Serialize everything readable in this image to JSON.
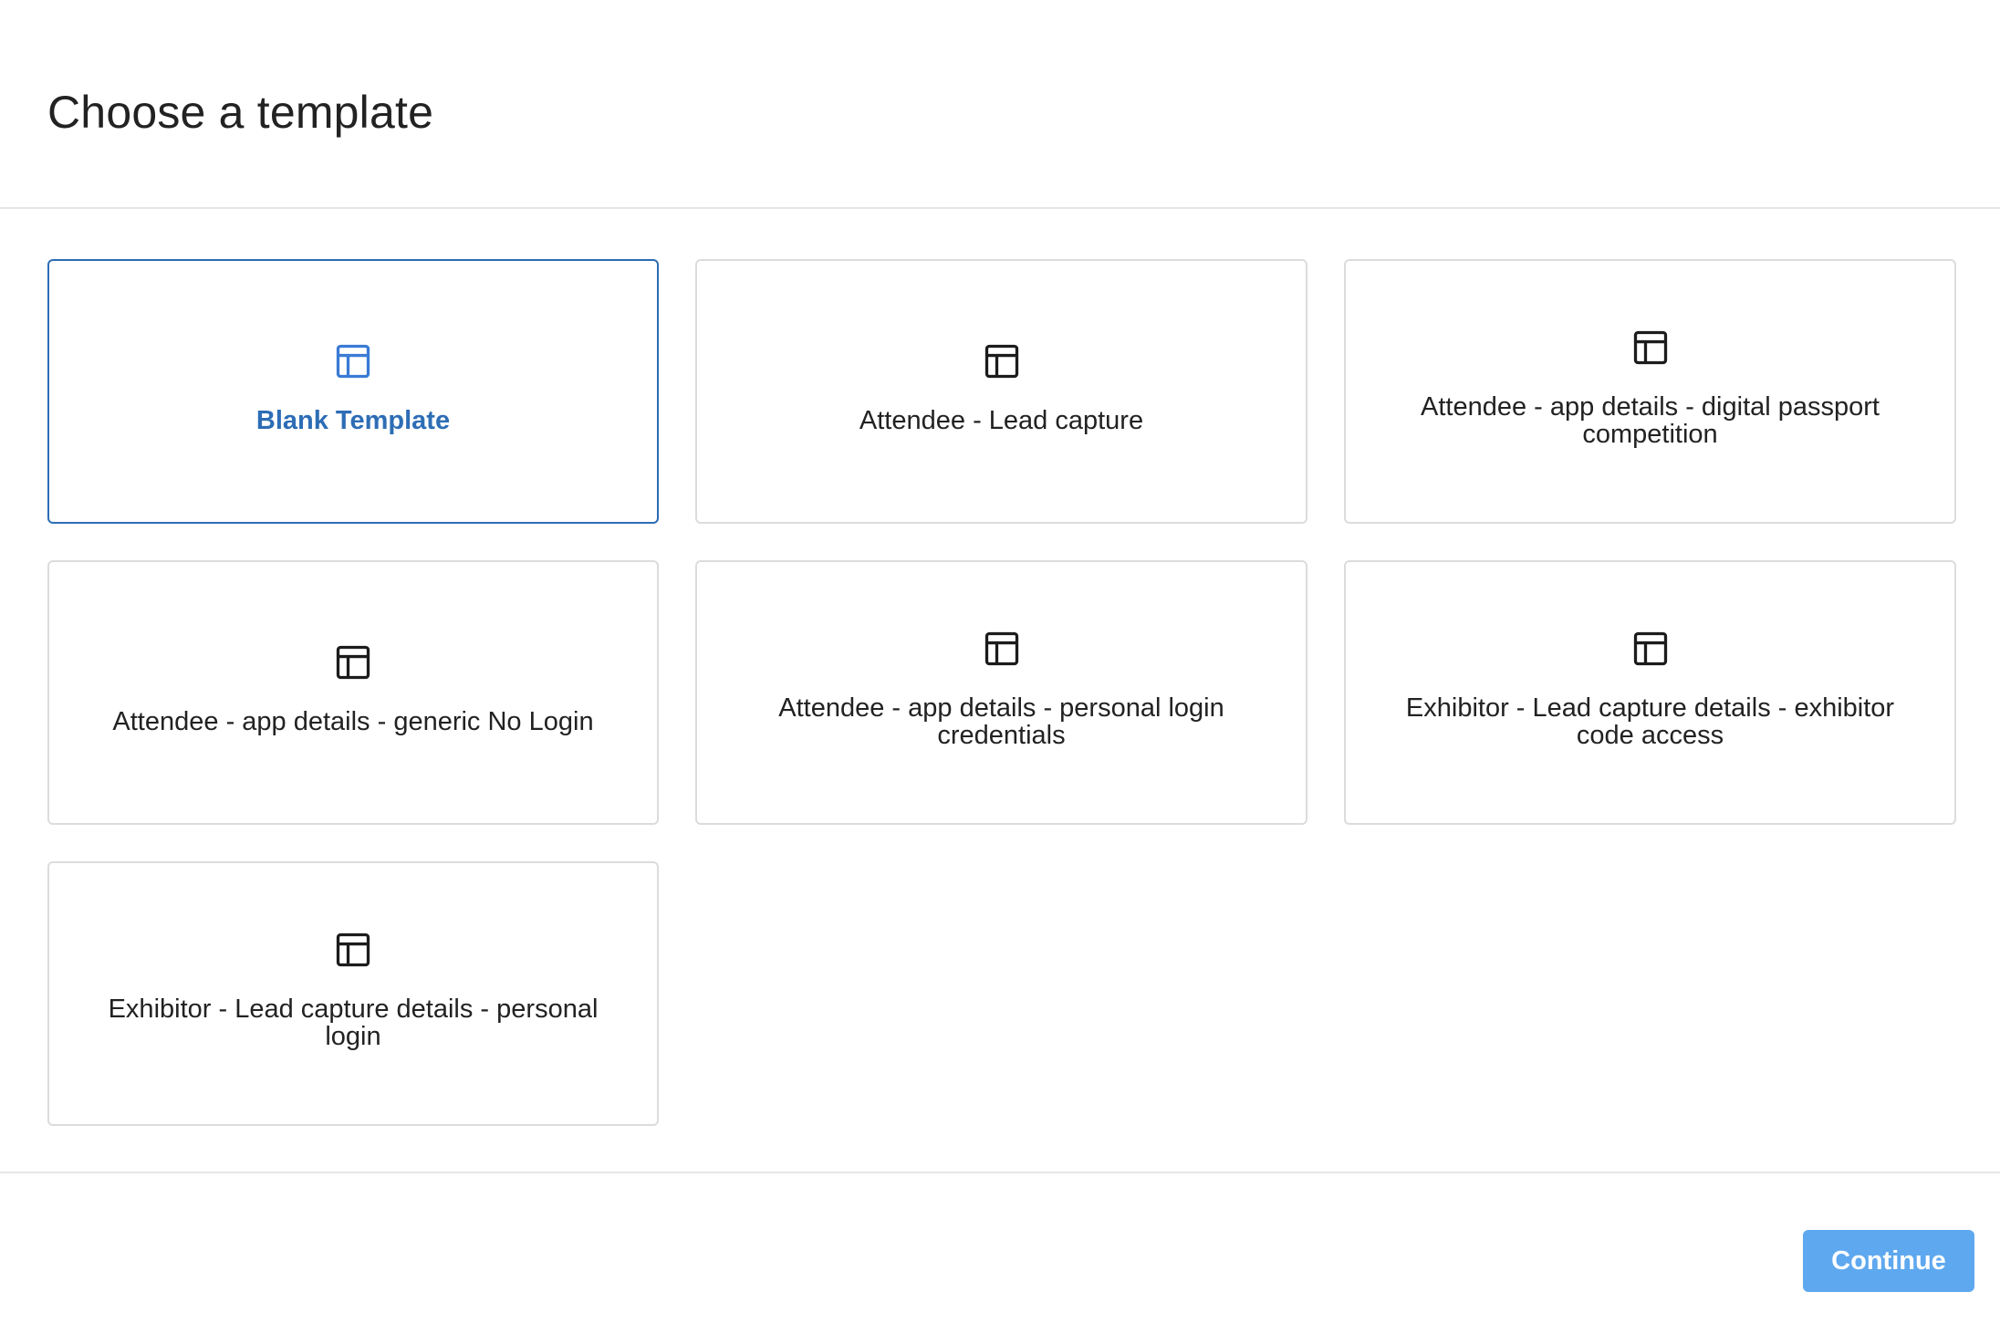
{
  "header": {
    "title": "Choose a template"
  },
  "templates": [
    {
      "label": "Blank Template",
      "icon": "layout-template-icon",
      "selected": true
    },
    {
      "label": "Attendee - Lead capture",
      "icon": "layout-template-icon",
      "selected": false
    },
    {
      "label": "Attendee - app details - digital passport competition",
      "icon": "layout-template-icon",
      "selected": false
    },
    {
      "label": "Attendee - app details - generic No Login",
      "icon": "layout-template-icon",
      "selected": false
    },
    {
      "label": "Attendee - app details - personal login credentials",
      "icon": "layout-template-icon",
      "selected": false
    },
    {
      "label": "Exhibitor - Lead capture details - exhibitor code access",
      "icon": "layout-template-icon",
      "selected": false
    },
    {
      "label": "Exhibitor - Lead capture details - personal login",
      "icon": "layout-template-icon",
      "selected": false
    }
  ],
  "footer": {
    "continue_label": "Continue"
  },
  "colors": {
    "selected_border": "#2d6db5",
    "selected_text": "#2d6db5",
    "selected_icon": "#3a7bd5",
    "continue_button": "#5ea8ef",
    "card_border": "#dcdcdc"
  }
}
